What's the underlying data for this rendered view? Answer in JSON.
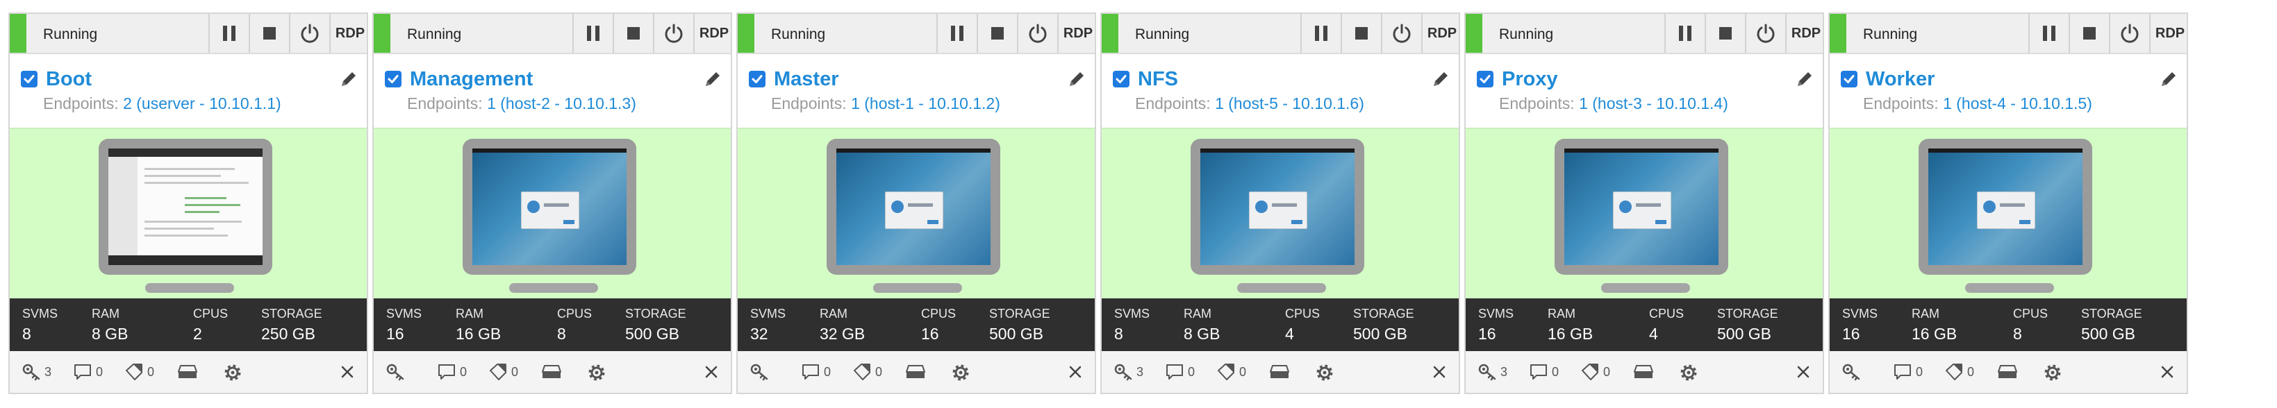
{
  "vms": [
    {
      "status": "Running",
      "name": "Boot",
      "endpoints_label": "Endpoints:",
      "endpoints_value": "2 (userver - 10.10.1.1)",
      "screen": "desktop",
      "rdp": "RDP",
      "stats": {
        "svms_label": "SVMS",
        "svms": "8",
        "ram_label": "RAM",
        "ram": "8 GB",
        "cpus_label": "CPUS",
        "cpus": "2",
        "storage_label": "STORAGE",
        "storage": "250 GB"
      },
      "footer": {
        "keys": "3",
        "comments": "0",
        "tags": "0"
      }
    },
    {
      "status": "Running",
      "name": "Management",
      "endpoints_label": "Endpoints:",
      "endpoints_value": "1 (host-2 - 10.10.1.3)",
      "screen": "login",
      "rdp": "RDP",
      "stats": {
        "svms_label": "SVMS",
        "svms": "16",
        "ram_label": "RAM",
        "ram": "16 GB",
        "cpus_label": "CPUS",
        "cpus": "8",
        "storage_label": "STORAGE",
        "storage": "500 GB"
      },
      "footer": {
        "keys": "",
        "comments": "0",
        "tags": "0"
      }
    },
    {
      "status": "Running",
      "name": "Master",
      "endpoints_label": "Endpoints:",
      "endpoints_value": "1 (host-1 - 10.10.1.2)",
      "screen": "login",
      "rdp": "RDP",
      "stats": {
        "svms_label": "SVMS",
        "svms": "32",
        "ram_label": "RAM",
        "ram": "32 GB",
        "cpus_label": "CPUS",
        "cpus": "16",
        "storage_label": "STORAGE",
        "storage": "500 GB"
      },
      "footer": {
        "keys": "",
        "comments": "0",
        "tags": "0"
      }
    },
    {
      "status": "Running",
      "name": "NFS",
      "endpoints_label": "Endpoints:",
      "endpoints_value": "1 (host-5 - 10.10.1.6)",
      "screen": "login",
      "rdp": "RDP",
      "stats": {
        "svms_label": "SVMS",
        "svms": "8",
        "ram_label": "RAM",
        "ram": "8 GB",
        "cpus_label": "CPUS",
        "cpus": "4",
        "storage_label": "STORAGE",
        "storage": "500 GB"
      },
      "footer": {
        "keys": "3",
        "comments": "0",
        "tags": "0"
      }
    },
    {
      "status": "Running",
      "name": "Proxy",
      "endpoints_label": "Endpoints:",
      "endpoints_value": "1 (host-3 - 10.10.1.4)",
      "screen": "login",
      "rdp": "RDP",
      "stats": {
        "svms_label": "SVMS",
        "svms": "16",
        "ram_label": "RAM",
        "ram": "16 GB",
        "cpus_label": "CPUS",
        "cpus": "4",
        "storage_label": "STORAGE",
        "storage": "500 GB"
      },
      "footer": {
        "keys": "3",
        "comments": "0",
        "tags": "0"
      }
    },
    {
      "status": "Running",
      "name": "Worker",
      "endpoints_label": "Endpoints:",
      "endpoints_value": "1 (host-4 - 10.10.1.5)",
      "screen": "login",
      "rdp": "RDP",
      "stats": {
        "svms_label": "SVMS",
        "svms": "16",
        "ram_label": "RAM",
        "ram": "16 GB",
        "cpus_label": "CPUS",
        "cpus": "8",
        "storage_label": "STORAGE",
        "storage": "500 GB"
      },
      "footer": {
        "keys": "",
        "comments": "0",
        "tags": "0"
      }
    }
  ],
  "colors": {
    "running": "#58c33c",
    "accent": "#1f8bd8",
    "screen_bg": "#d4fdc6",
    "stats_bg": "#2f2f2f"
  },
  "icons": {
    "pause": "pause-icon",
    "stop": "stop-icon",
    "power": "power-icon",
    "edit": "pencil-icon",
    "keys": "key-icon",
    "comments": "comment-icon",
    "tags": "tag-icon",
    "drive": "drive-icon",
    "settings": "gear-icon",
    "close": "close-icon"
  }
}
